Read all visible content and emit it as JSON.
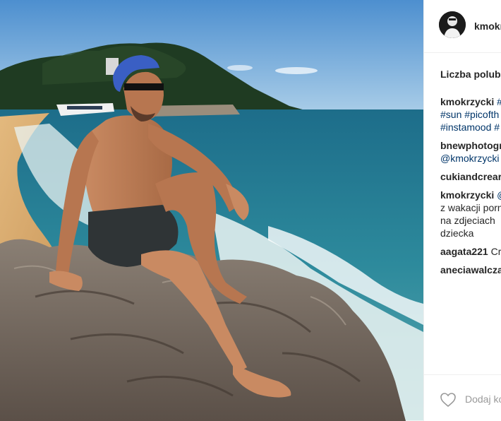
{
  "post": {
    "username": "kmokr",
    "likes_label": "Liczba polubi"
  },
  "comments": [
    {
      "user": "kmokrzycki",
      "lines": [
        {
          "text": " #",
          "tag": true
        },
        {
          "text": "#sun #picofth",
          "tag": true
        },
        {
          "text": "#instamood #",
          "tag": true
        }
      ]
    },
    {
      "user": "bnewphotogr",
      "lines": [
        {
          "text": "",
          "tag": false
        },
        {
          "text": "@kmokrzycki",
          "tag": true
        }
      ]
    },
    {
      "user": "cukiandcrear",
      "lines": [
        {
          "text": "",
          "tag": false
        }
      ]
    },
    {
      "user": "kmokrzycki",
      "lines": [
        {
          "text": " @",
          "tag": true
        },
        {
          "text": "z wakacji porn",
          "tag": false
        },
        {
          "text": "na zdjeciach",
          "tag": false
        },
        {
          "text": "dziecka",
          "tag": false
        }
      ]
    },
    {
      "user": "aagata221",
      "lines": [
        {
          "text": " Cr",
          "tag": false
        }
      ]
    },
    {
      "user": "aneciawalcza",
      "lines": [
        {
          "text": "",
          "tag": false
        }
      ]
    }
  ],
  "footer": {
    "add_comment_placeholder": "Dodaj ko",
    "heart_icon": "heart-outline-icon"
  },
  "colors": {
    "text": "#262626",
    "hashtag": "#003569",
    "muted": "#999999",
    "border": "#efefef"
  }
}
